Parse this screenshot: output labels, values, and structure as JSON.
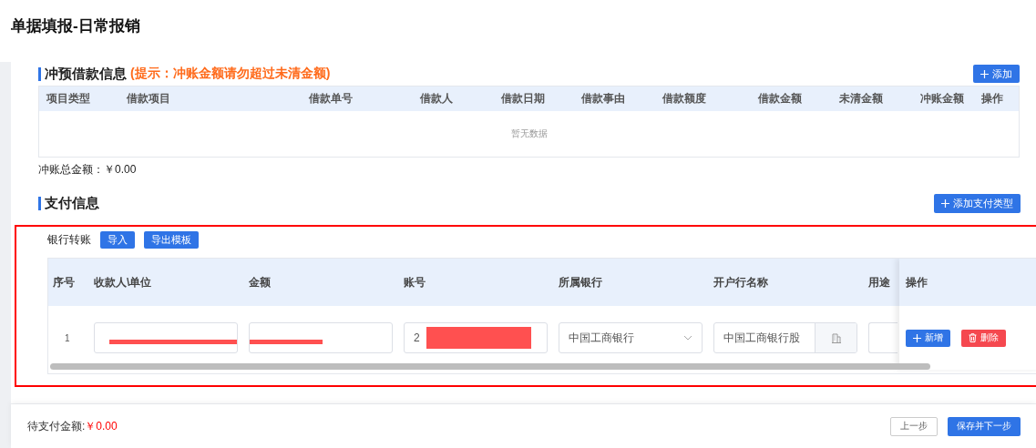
{
  "page_title": "单据填报-日常报销",
  "offset_section": {
    "title": "冲预借款信息",
    "hint": "(提示：冲账金额请勿超过未清金额)",
    "add_button": "添加",
    "columns": [
      "项目类型",
      "借款项目",
      "借款单号",
      "借款人",
      "借款日期",
      "借款事由",
      "借款额度",
      "借款金额",
      "未清金额",
      "冲账金额",
      "操作"
    ],
    "empty_text": "暂无数据",
    "total_label": "冲账总金额：",
    "total_value": "￥0.00"
  },
  "payment_section": {
    "title": "支付信息",
    "add_button": "添加支付类型",
    "groups": [
      {
        "label": "银行转账",
        "buttons": [
          "导入",
          "导出模板"
        ],
        "columns": [
          "序号",
          "收款人\\单位",
          "金额",
          "账号",
          "所属银行",
          "开户行名称",
          "用途",
          "操作"
        ],
        "rows": [
          {
            "index": "1",
            "payee_redacted": true,
            "amount_redacted": true,
            "account_prefix": "2",
            "account_redacted": true,
            "bank": "中国工商银行",
            "branch": "中国工商银行股",
            "actions": [
              {
                "kind": "add",
                "label": "新增"
              },
              {
                "kind": "delete",
                "label": "删除"
              }
            ]
          }
        ]
      }
    ]
  },
  "footer": {
    "label": "待支付金额:",
    "value": "￥0.00",
    "buttons": [
      {
        "kind": "secondary",
        "label": "上一步"
      },
      {
        "kind": "primary",
        "label": "保存并下一步"
      }
    ]
  }
}
